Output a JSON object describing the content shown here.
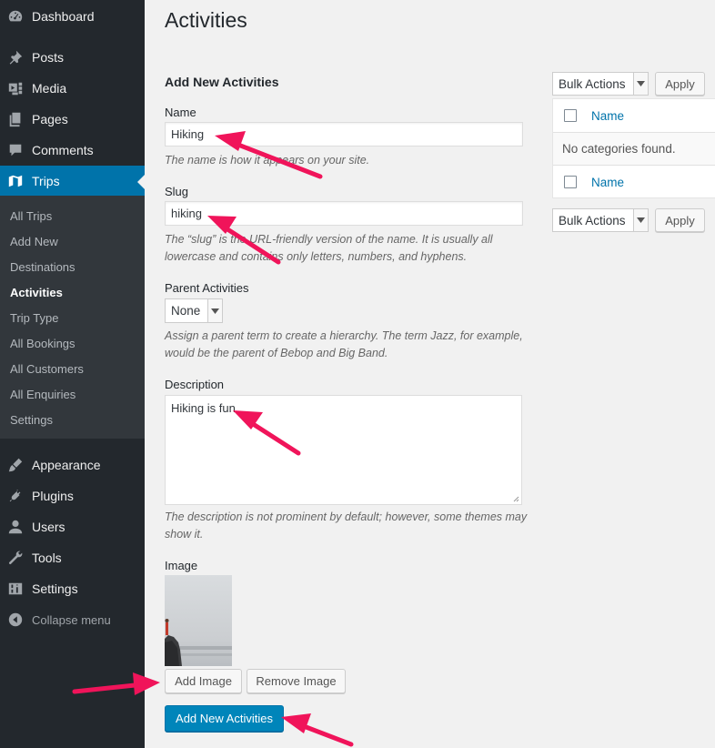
{
  "sidebar": {
    "menu": [
      {
        "label": "Dashboard",
        "icon": "dashboard-icon"
      },
      {
        "label": "Posts",
        "icon": "pin-icon"
      },
      {
        "label": "Media",
        "icon": "media-icon"
      },
      {
        "label": "Pages",
        "icon": "pages-icon"
      },
      {
        "label": "Comments",
        "icon": "comment-icon"
      },
      {
        "label": "Trips",
        "icon": "map-icon"
      }
    ],
    "submenu": [
      "All Trips",
      "Add New",
      "Destinations",
      "Activities",
      "Trip Type",
      "All Bookings",
      "All Customers",
      "All Enquiries",
      "Settings"
    ],
    "menu2": [
      {
        "label": "Appearance",
        "icon": "brush-icon"
      },
      {
        "label": "Plugins",
        "icon": "plug-icon"
      },
      {
        "label": "Users",
        "icon": "user-icon"
      },
      {
        "label": "Tools",
        "icon": "wrench-icon"
      },
      {
        "label": "Settings",
        "icon": "sliders-icon"
      }
    ],
    "collapse": "Collapse menu",
    "active_submenu": "Activities",
    "accent_color": "#0073aa"
  },
  "page": {
    "title": "Activities"
  },
  "form": {
    "title": "Add New Activities",
    "name_label": "Name",
    "name_value": "Hiking",
    "name_help": "The name is how it appears on your site.",
    "slug_label": "Slug",
    "slug_value": "hiking",
    "slug_help": "The “slug” is the URL-friendly version of the name. It is usually all lowercase and contains only letters, numbers, and hyphens.",
    "parent_label": "Parent Activities",
    "parent_value": "None",
    "parent_help": "Assign a parent term to create a hierarchy. The term Jazz, for example, would be the parent of Bebop and Big Band.",
    "description_label": "Description",
    "description_value": "Hiking is fun..",
    "description_help": "The description is not prominent by default; however, some themes may show it.",
    "image_label": "Image",
    "add_image": "Add Image",
    "remove_image": "Remove Image",
    "submit": "Add New Activities"
  },
  "list": {
    "bulk_actions": "Bulk Actions",
    "apply": "Apply",
    "column_name": "Name",
    "empty": "No categories found."
  },
  "annotations": {
    "arrow_color": "#f0145a"
  }
}
